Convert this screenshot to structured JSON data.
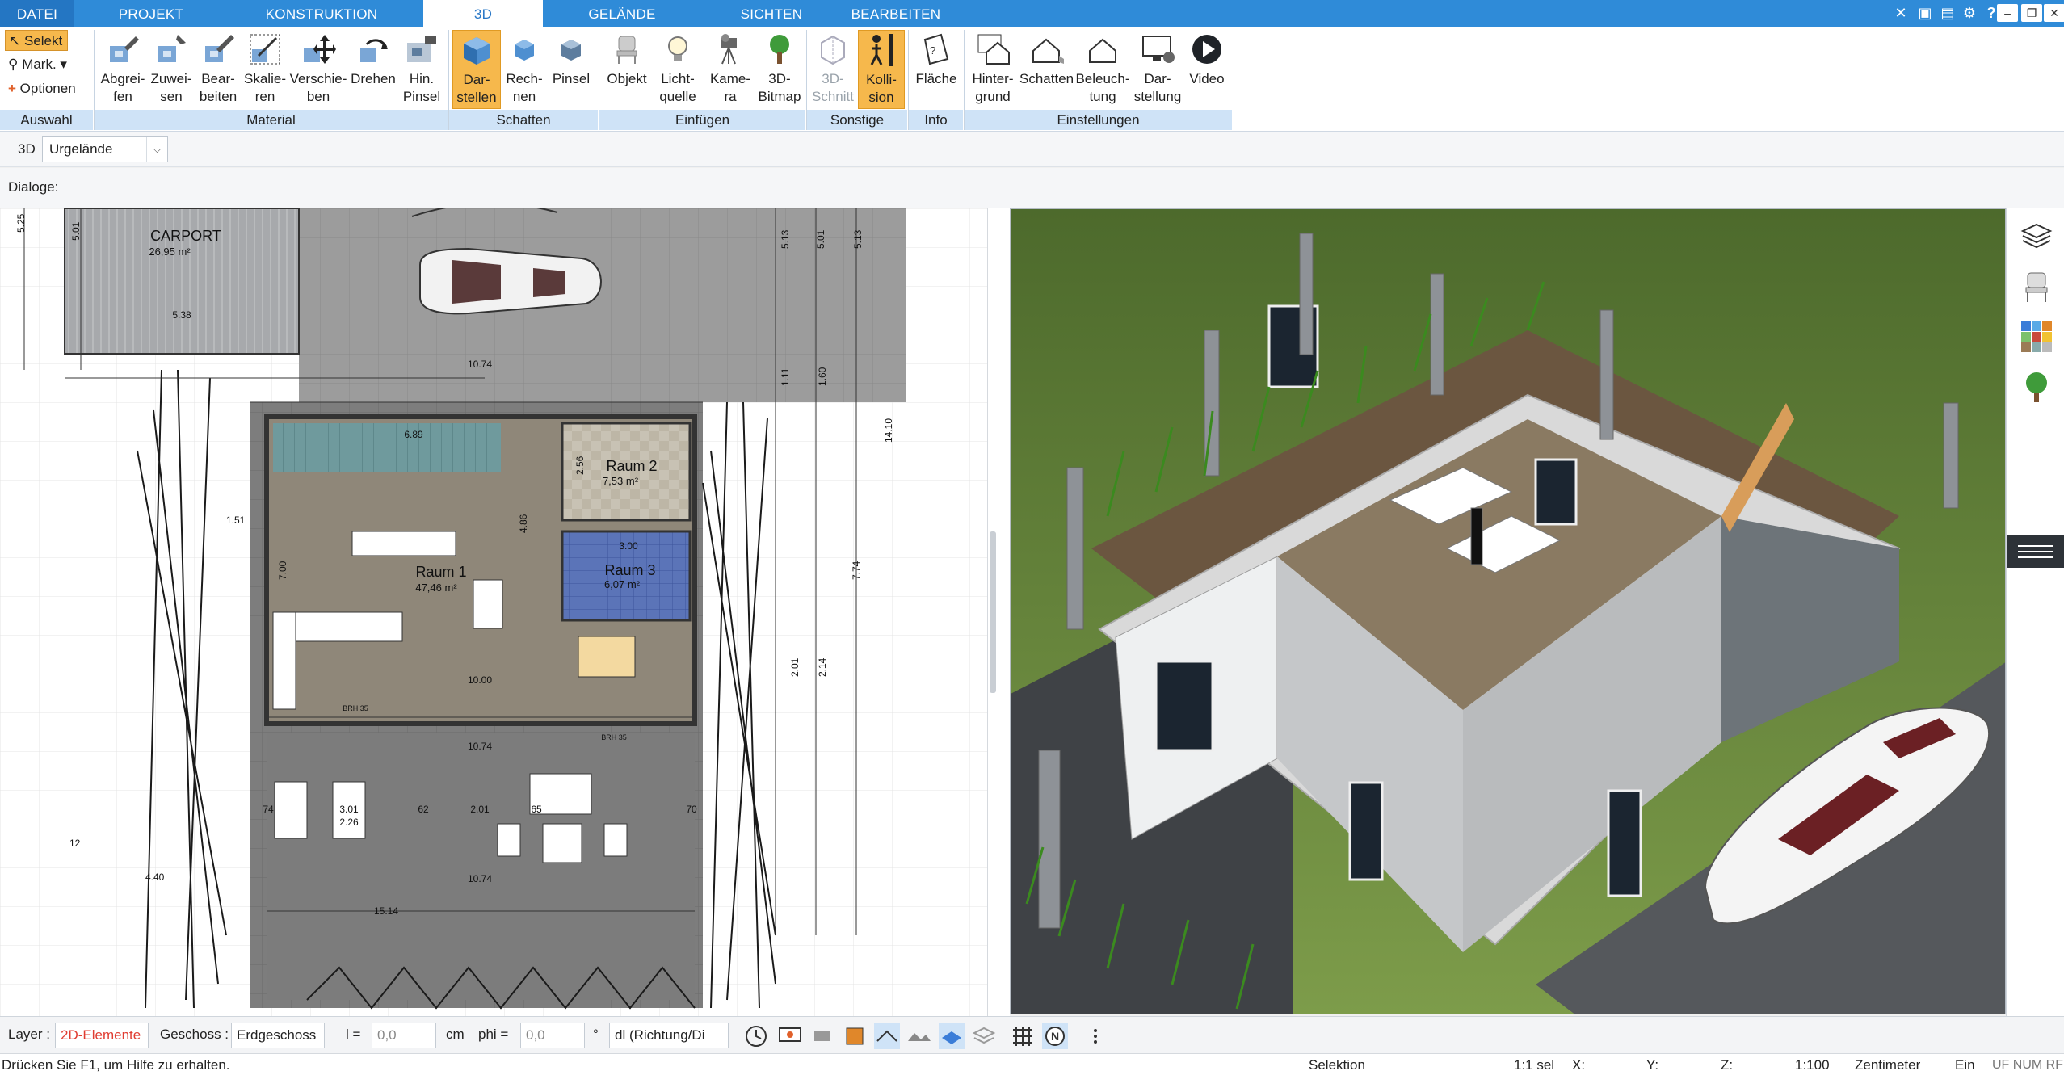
{
  "menu_tabs": [
    {
      "label": "DATEI"
    },
    {
      "label": "PROJEKT"
    },
    {
      "label": "KONSTRUKTION"
    },
    {
      "label": "3D"
    },
    {
      "label": "GELÄNDE"
    },
    {
      "label": "SICHTEN"
    },
    {
      "label": "BEARBEITEN"
    }
  ],
  "ribbon": {
    "auswahl": {
      "label": "Auswahl",
      "select": "Selekt",
      "mark": "Mark.",
      "options": "Optionen"
    },
    "material": {
      "label": "Material",
      "buttons": [
        "Abgrei-\nfen",
        "Zuwei-\nsen",
        "Bear-\nbeiten",
        "Skalie-\nren",
        "Verschie-\nben",
        "Drehen",
        "Hin.\nPinsel"
      ]
    },
    "schatten": {
      "label": "Schatten",
      "buttons": [
        "Dar-\nstellen",
        "Rech-\nnen",
        "Pinsel"
      ]
    },
    "einfuegen": {
      "label": "Einfügen",
      "buttons": [
        "Objekt",
        "Licht-\nquelle",
        "Kame-\nra",
        "3D-\nBitmap"
      ]
    },
    "sonstige": {
      "label": "Sonstige",
      "buttons": [
        "3D-\nSchnitt",
        "Kolli-\nsion"
      ]
    },
    "info": {
      "label": "Info",
      "buttons": [
        "Fläche"
      ]
    },
    "einstellungen": {
      "label": "Einstellungen",
      "buttons": [
        "Hinter-\ngrund",
        "Schatten",
        "Beleuch-\ntung",
        "Dar-\nstellung",
        "Video"
      ]
    }
  },
  "subbar": {
    "mode": "3D",
    "terrain": "Urgelände",
    "dialoge": "Dialoge:"
  },
  "plan": {
    "rooms": [
      {
        "name": "CARPORT",
        "area": "26,95 m²"
      },
      {
        "name": "Raum 1",
        "area": "47,46 m²"
      },
      {
        "name": "Raum 2",
        "area": "7,53 m²"
      },
      {
        "name": "Raum 3",
        "area": "6,07 m²"
      }
    ],
    "dims": [
      "5.25",
      "5.01",
      "5.38",
      "10.74",
      "6.89",
      "2.56",
      "4.86",
      "7.00",
      "10.00",
      "10.74",
      "10.74",
      "15.14",
      "3.00",
      "3.01",
      "2.26",
      "2.01",
      "62",
      "65",
      "70",
      "74",
      "5.13",
      "5.01",
      "5.13",
      "14.10",
      "7.74",
      "1.60",
      "1.11",
      "2.14",
      "2.01",
      "1.51",
      "4.40",
      "12",
      "BRH 35",
      "BRH 35"
    ]
  },
  "bottom": {
    "layer_label": "Layer :",
    "layer_value": "2D-Elemente",
    "geschoss_label": "Geschoss :",
    "geschoss_value": "Erdgeschoss",
    "l_label": "l =",
    "l_value": "0,0",
    "unit": "cm",
    "phi_label": "phi =",
    "phi_value": "0,0",
    "deg": "°",
    "dl_value": "dl (Richtung/Di"
  },
  "status": {
    "help": "Drücken Sie F1, um Hilfe zu erhalten.",
    "mode": "Selektion",
    "scale_sel": "1:1 sel",
    "x": "X:",
    "y": "Y:",
    "z": "Z:",
    "scale": "1:100",
    "unit": "Zentimeter",
    "ein": "Ein",
    "flags": "UF NUM RF"
  },
  "colors": {
    "accent": "#2f8bd8",
    "active_button": "#f6b84c",
    "group_label": "#cfe3f7",
    "layer_red": "#e03c31"
  }
}
